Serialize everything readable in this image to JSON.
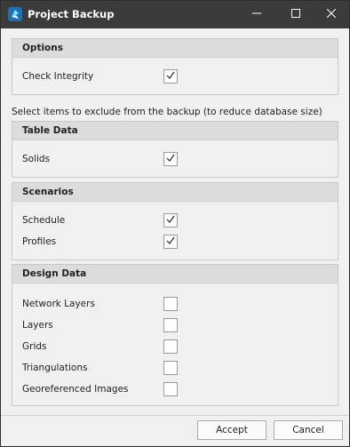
{
  "window": {
    "title": "Project Backup",
    "minimize_icon": "minimize-icon",
    "maximize_icon": "maximize-icon",
    "close_icon": "close-icon"
  },
  "options": {
    "header": "Options",
    "items": [
      {
        "label": "Check Integrity",
        "checked": true
      }
    ]
  },
  "exclude_note": "Select items to exclude from the backup (to reduce database size)",
  "table_data": {
    "header": "Table Data",
    "items": [
      {
        "label": "Solids",
        "checked": true
      }
    ]
  },
  "scenarios": {
    "header": "Scenarios",
    "items": [
      {
        "label": "Schedule",
        "checked": true
      },
      {
        "label": "Profiles",
        "checked": true
      }
    ]
  },
  "design_data": {
    "header": "Design Data",
    "items": [
      {
        "label": "Network Layers",
        "checked": false
      },
      {
        "label": "Layers",
        "checked": false
      },
      {
        "label": "Grids",
        "checked": false
      },
      {
        "label": "Triangulations",
        "checked": false
      },
      {
        "label": "Georeferenced Images",
        "checked": false
      }
    ]
  },
  "buttons": {
    "accept": "Accept",
    "cancel": "Cancel"
  },
  "colors": {
    "titlebar": "#3b3b3b",
    "background": "#f0f0f0",
    "group_header": "#dcdcdc"
  }
}
